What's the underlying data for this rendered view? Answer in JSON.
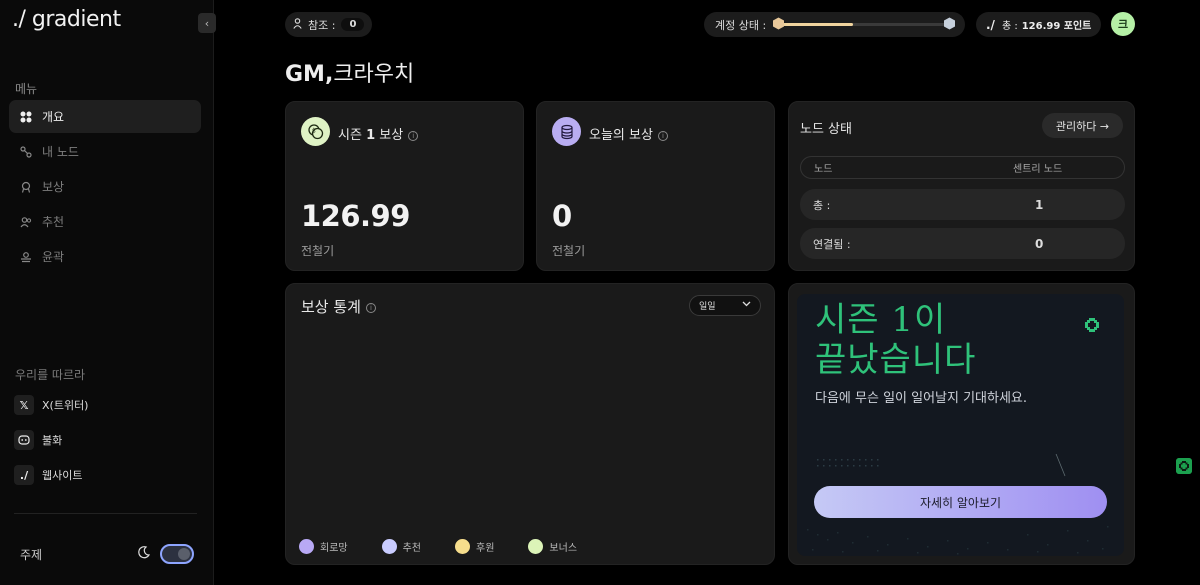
{
  "app": {
    "logo": "./ gradient"
  },
  "sidebar": {
    "menu_label": "메뉴",
    "items": [
      {
        "label": "개요",
        "icon": "grid-icon",
        "active": true
      },
      {
        "label": "내 노드",
        "icon": "nodes-icon",
        "active": false
      },
      {
        "label": "보상",
        "icon": "award-icon",
        "active": false
      },
      {
        "label": "추천",
        "icon": "users-icon",
        "active": false
      },
      {
        "label": "윤곽",
        "icon": "profile-icon",
        "active": false
      }
    ],
    "follow_label": "우리를 따르라",
    "socials": [
      {
        "label": "X(트위터)",
        "icon": "x-icon"
      },
      {
        "label": "불화",
        "icon": "discord-icon"
      },
      {
        "label": "웹사이트",
        "icon": "gradient-logo-icon"
      }
    ],
    "theme_label": "주제"
  },
  "topbar": {
    "referral_label": "참조 :",
    "referral_count": "0",
    "account_status_label": "계정 상태 :",
    "account_progress": 0.45,
    "points_logo": "./",
    "points_label": "총 :",
    "points_value": "126.99 포인트",
    "avatar_letter": "크"
  },
  "greeting": {
    "gm": "GM,",
    "name": "크라우치"
  },
  "season_card": {
    "title_prefix": "시즌 ",
    "title_num": "1",
    "title_suffix": " 보상",
    "value": "126.99",
    "unit": "전철기"
  },
  "today_card": {
    "title": "오늘의 보상",
    "value": "0",
    "unit": "전철기"
  },
  "node_status": {
    "title": "노드 상태",
    "manage_label": "관리하다 →",
    "col_node": "노드",
    "col_sentry": "센트리 노드",
    "rows": [
      {
        "label": "총 :",
        "value": "1"
      },
      {
        "label": "연결됨 :",
        "value": "0"
      }
    ]
  },
  "reward_stats": {
    "title": "보상 통계",
    "period": "일일",
    "legend": [
      {
        "label": "회로망",
        "color": "#b8a9f5"
      },
      {
        "label": "추천",
        "color": "#c9ccff"
      },
      {
        "label": "후원",
        "color": "#f6dd8c"
      },
      {
        "label": "보너스",
        "color": "#dcf4b8"
      }
    ]
  },
  "promo": {
    "title_line1": "시즌 1이",
    "title_line2": "끝났습니다",
    "subtitle": "다음에 무슨 일이 일어날지 기대하세요.",
    "button": "자세히 알아보기"
  },
  "colors": {
    "accent_green": "#2fc27a",
    "button_gradient_start": "#c5c9f5",
    "button_gradient_end": "#9f8ff2"
  }
}
